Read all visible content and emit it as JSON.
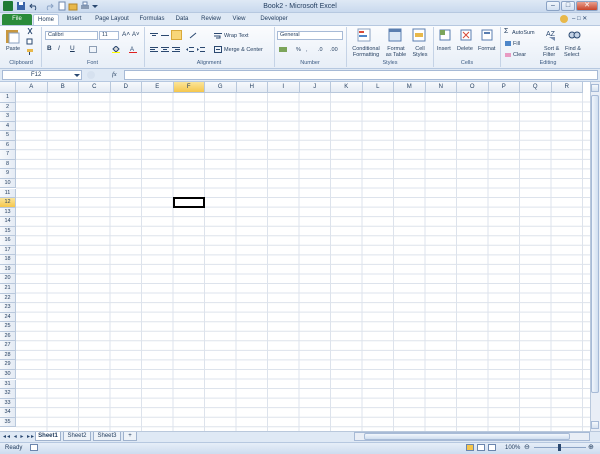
{
  "window": {
    "title": "Book2 - Microsoft Excel"
  },
  "tabs": [
    "File",
    "Home",
    "Insert",
    "Page Layout",
    "Formulas",
    "Data",
    "Review",
    "View",
    "Developer"
  ],
  "ribbon": {
    "clipboard": {
      "label": "Clipboard",
      "paste": "Paste"
    },
    "font": {
      "label": "Font",
      "family": "Calibri",
      "size": "11",
      "bold": "B",
      "italic": "I",
      "underline": "U"
    },
    "alignment": {
      "label": "Alignment",
      "wrap": "Wrap Text",
      "merge": "Merge & Center"
    },
    "number": {
      "label": "Number",
      "format": "General",
      "percent": "%"
    },
    "styles": {
      "label": "Styles",
      "conditional": [
        "Conditional",
        "Formatting"
      ],
      "format_table": [
        "Format",
        "as Table"
      ],
      "cell_styles": [
        "Cell",
        "Styles"
      ]
    },
    "cells": {
      "label": "Cells",
      "insert": "Insert",
      "delete": "Delete",
      "format": "Format"
    },
    "editing": {
      "label": "Editing",
      "autosum": "AutoSum",
      "fill": "Fill",
      "clear": "Clear",
      "sort": [
        "Sort &",
        "Filter"
      ],
      "find": [
        "Find &",
        "Select"
      ]
    }
  },
  "formula_bar": {
    "name_box": "F12",
    "fx": "fx",
    "value": ""
  },
  "columns": [
    "A",
    "B",
    "C",
    "D",
    "E",
    "F",
    "G",
    "H",
    "I",
    "J",
    "K",
    "L",
    "M",
    "N",
    "O",
    "P",
    "Q",
    "R"
  ],
  "rows": [
    "1",
    "2",
    "3",
    "4",
    "5",
    "6",
    "7",
    "8",
    "9",
    "10",
    "11",
    "12",
    "13",
    "14",
    "15",
    "16",
    "17",
    "18",
    "19",
    "20",
    "21",
    "22",
    "23",
    "24",
    "25",
    "26",
    "27",
    "28",
    "29",
    "30",
    "31",
    "32",
    "33",
    "34",
    "35"
  ],
  "active_cell": {
    "col": "F",
    "row": "12"
  },
  "sheets": [
    "Sheet1",
    "Sheet2",
    "Sheet3"
  ],
  "active_sheet": "Sheet1",
  "status": {
    "state": "Ready",
    "zoom": "100%"
  },
  "colors": {
    "file_tab": "#2a8b3a",
    "active_header": "#f5c64c",
    "grid_line": "#dde3ec"
  }
}
